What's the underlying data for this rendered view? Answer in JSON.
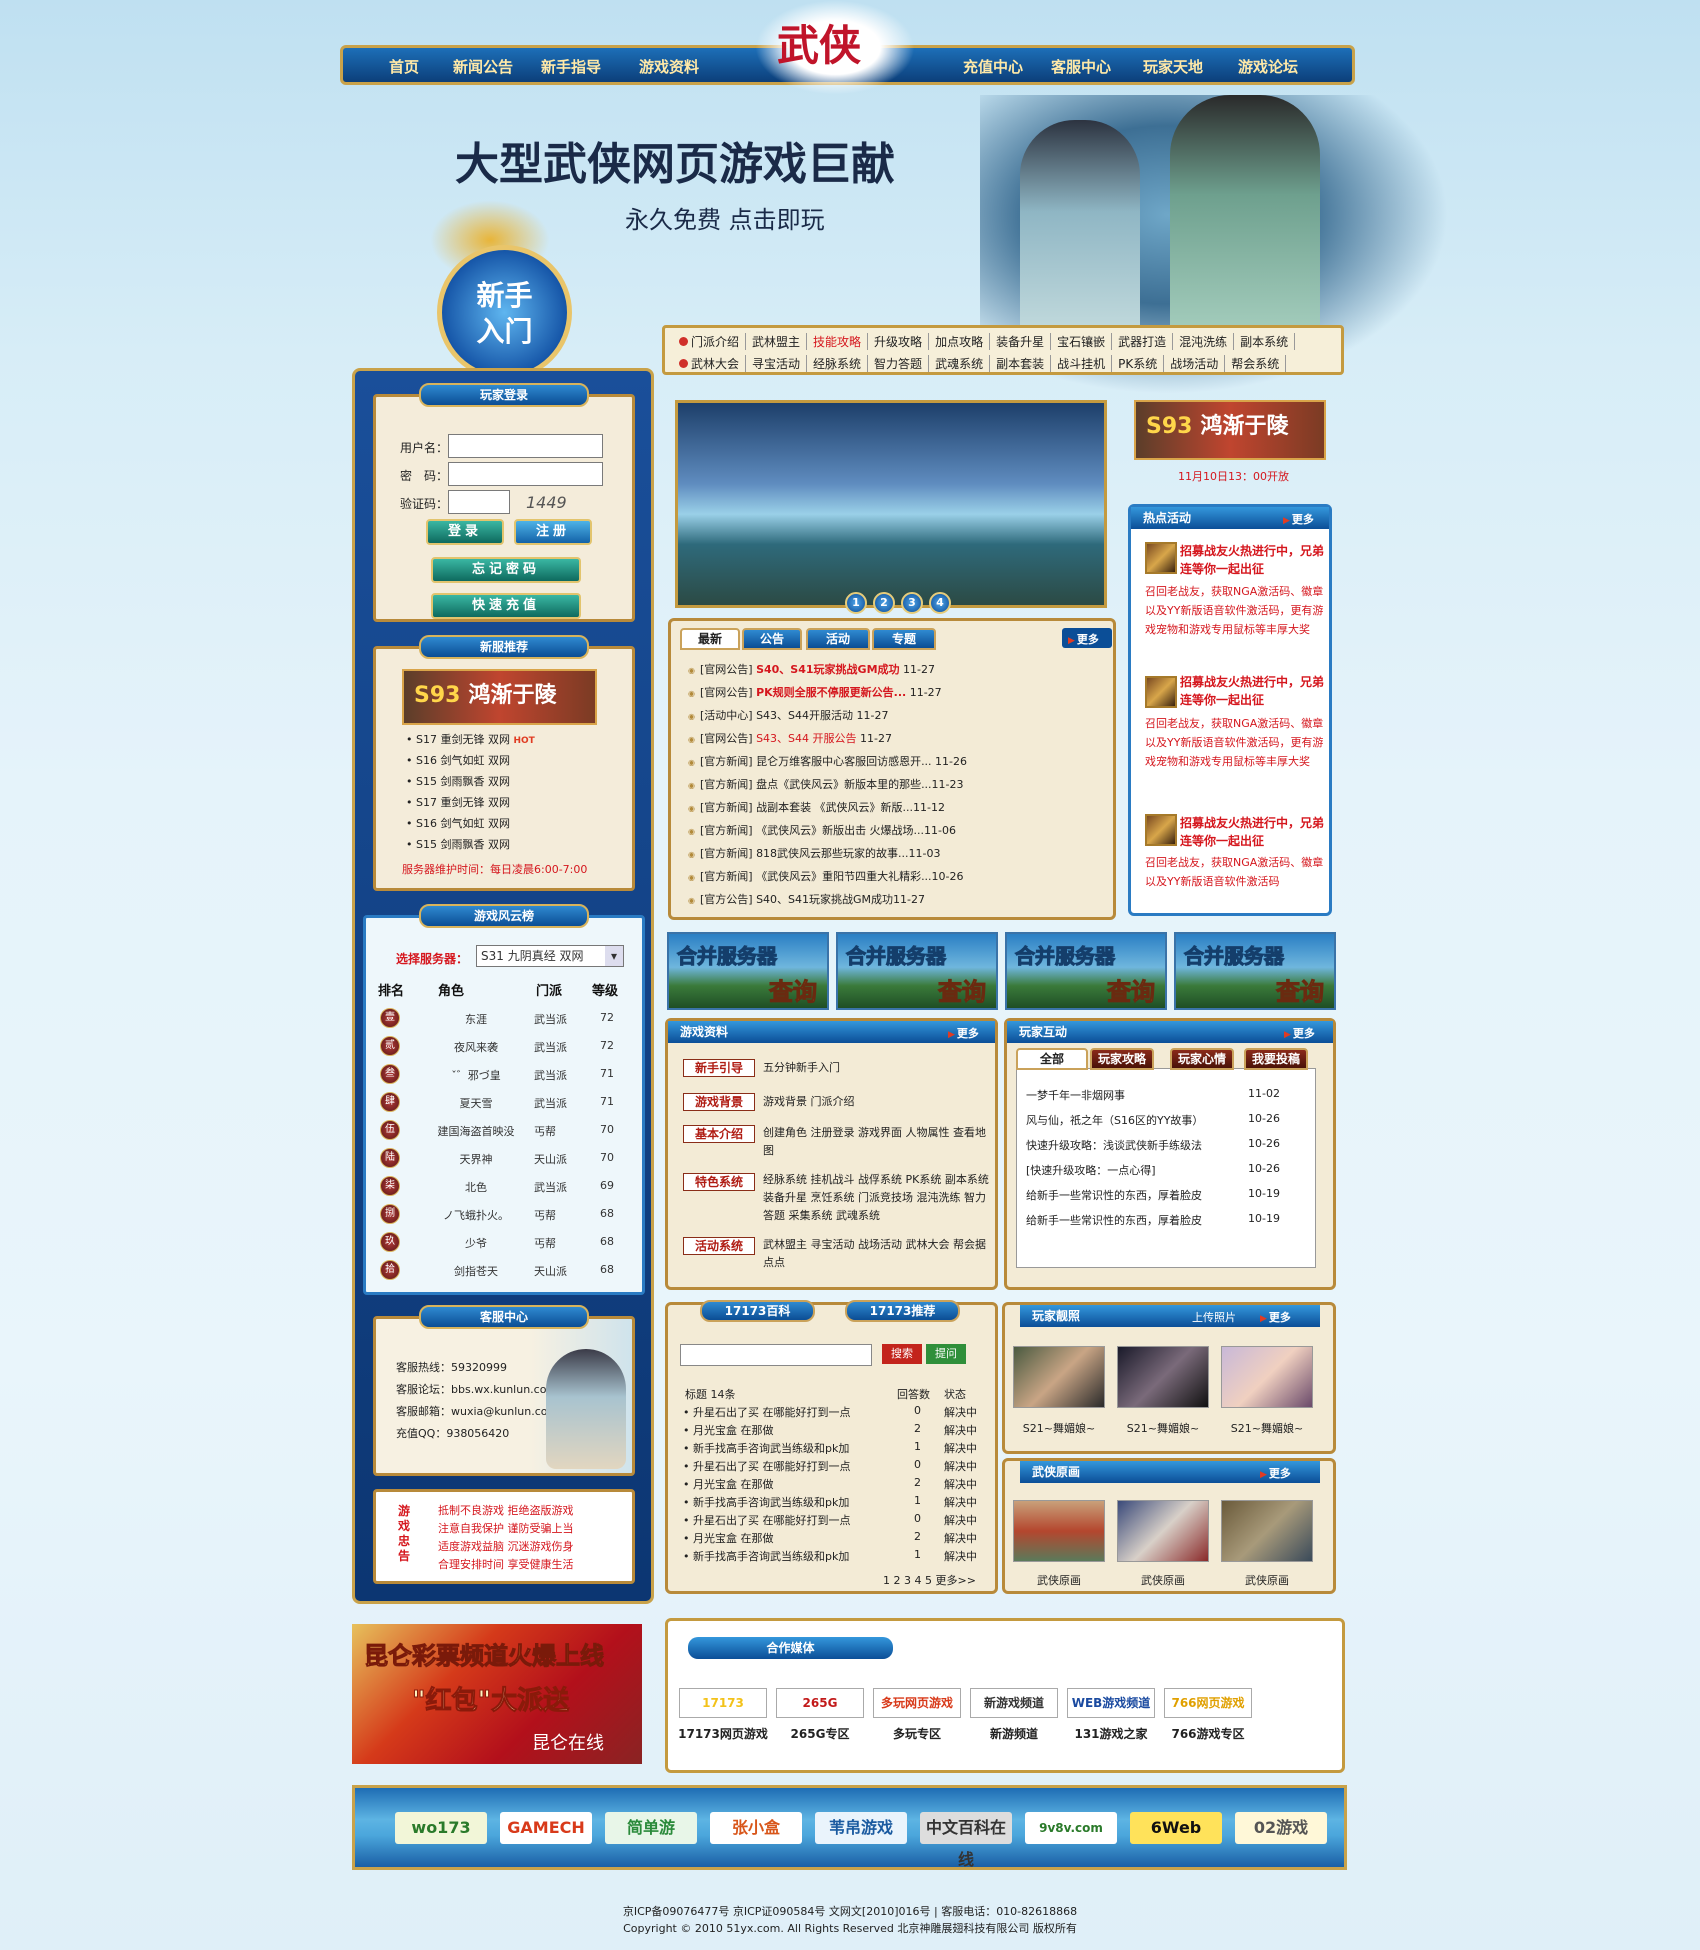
{
  "nav": {
    "left": [
      "首页",
      "新闻公告",
      "新手指导",
      "游戏资料"
    ],
    "right": [
      "充值中心",
      "客服中心",
      "玩家天地",
      "游戏论坛"
    ],
    "logo": "武侠"
  },
  "hero": {
    "title": "大型武侠网页游戏巨献",
    "subtitle": "永久免费 点击即玩",
    "newbie": "新手入门"
  },
  "links": {
    "row1": [
      "门派介绍",
      "武林盟主",
      "技能攻略",
      "升级攻略",
      "加点攻略",
      "装备升星",
      "宝石镶嵌",
      "武器打造",
      "混沌洗练",
      "副本系统"
    ],
    "row2": [
      "武林大会",
      "寻宝活动",
      "经脉系统",
      "智力答题",
      "武魂系统",
      "副本套装",
      "战斗挂机",
      "PK系统",
      "战场活动",
      "帮会系统"
    ]
  },
  "login": {
    "title": "玩家登录",
    "user_label": "用户名：",
    "pass_label": "密　码：",
    "code_label": "验证码：",
    "captcha": "1449",
    "login_btn": "登录",
    "register_btn": "注册",
    "forgot_btn": "忘记密码",
    "recharge_btn": "快速充值"
  },
  "servers": {
    "title": "新服推荐",
    "banner_num": "S93",
    "banner_text": "鸿渐于陵",
    "list": [
      "• S17  重剑无锋  双网",
      "• S16  剑气如虹  双网",
      "• S15  剑雨飘香  双网",
      "• S17  重剑无锋  双网",
      "• S16  剑气如虹  双网",
      "• S15  剑雨飘香  双网"
    ],
    "hot": "HOT",
    "maint": "服务器维护时间：每日凌晨6:00-7:00"
  },
  "ranking": {
    "title": "游戏风云榜",
    "select_label": "选择服务器：",
    "selected": "S31 九阴真经  双网",
    "headers": [
      "排名",
      "角色",
      "门派",
      "等级"
    ],
    "rows": [
      [
        "壹",
        "东涯",
        "武当派",
        "72"
      ],
      [
        "贰",
        "夜风来袭",
        "武当派",
        "72"
      ],
      [
        "叁",
        "ˇ゛邪づ皇",
        "武当派",
        "71"
      ],
      [
        "肆",
        "夏天雪",
        "武当派",
        "71"
      ],
      [
        "伍",
        "建国海盗首映没",
        "丐帮",
        "70"
      ],
      [
        "陆",
        "天界神",
        "天山派",
        "70"
      ],
      [
        "柒",
        "北色",
        "武当派",
        "69"
      ],
      [
        "捌",
        "ノ飞蛾扑火。",
        "丐帮",
        "68"
      ],
      [
        "玖",
        "少爷",
        "丐帮",
        "68"
      ],
      [
        "拾",
        "剑指苍天",
        "天山派",
        "68"
      ]
    ]
  },
  "service": {
    "title": "客服中心",
    "lines": [
      "客服热线：59320999",
      "客服论坛：bbs.wx.kunlun.com",
      "客服邮箱：wuxia@kunlun.com",
      "充值QQ：938056420"
    ]
  },
  "advice": {
    "title": "游戏忠告",
    "lines": [
      "抵制不良游戏 拒绝盗版游戏",
      "注意自我保护 谨防受骗上当",
      "适度游戏益脑 沉迷游戏伤身",
      "合理安排时间 享受健康生活"
    ]
  },
  "carousel": {
    "pages": [
      "1",
      "2",
      "3",
      "4"
    ]
  },
  "news": {
    "tabs": [
      "最新",
      "公告",
      "活动",
      "专题"
    ],
    "more": "更多",
    "items": [
      {
        "pre": "[官网公告] ",
        "hl": "S40、S41玩家挑战GM成功",
        "post": " 11-27"
      },
      {
        "pre": "[官网公告] ",
        "hl": "PK规则全服不停服更新公告...",
        "post": " 11-27"
      },
      {
        "pre": "[活动中心] S43、S44开服活动 11-27",
        "hl": "",
        "post": ""
      },
      {
        "pre": "[官网公告] ",
        "hl2": "S43、S44 开服公告",
        "post": " 11-27"
      },
      {
        "pre": "[官方新闻] 昆仑万维客服中心客服回访感恩开... 11-26",
        "hl": "",
        "post": ""
      },
      {
        "pre": "[官方新闻] 盘点《武侠风云》新版本里的那些...11-23",
        "hl": "",
        "post": ""
      },
      {
        "pre": "[官方新闻] 战副本套装 《武侠风云》新版...11-12",
        "hl": "",
        "post": ""
      },
      {
        "pre": "[官方新闻] 《武侠风云》新版出击 火爆战场...11-06",
        "hl": "",
        "post": ""
      },
      {
        "pre": "[官方新闻] 818武侠风云那些玩家的故事...11-03",
        "hl": "",
        "post": ""
      },
      {
        "pre": "[官方新闻] 《武侠风云》重阳节四重大礼精彩...10-26",
        "hl": "",
        "post": ""
      },
      {
        "pre": "[官方公告] S40、S41玩家挑战GM成功11-27",
        "hl": "",
        "post": ""
      }
    ]
  },
  "right_top": {
    "banner_num": "S93",
    "banner_text": "鸿渐于陵",
    "open_time": "11月10日13：00开放"
  },
  "hot_events": {
    "title": "热点活动",
    "more": "更多",
    "items": [
      {
        "title": "招募战友火热进行中，兄弟连等你一起出征",
        "desc": "召回老战友，获取NGA激活码、徽章以及YY新版语音软件激活码，更有游戏宠物和游戏专用鼠标等丰厚大奖"
      },
      {
        "title": "招募战友火热进行中，兄弟连等你一起出征",
        "desc": "召回老战友，获取NGA激活码、徽章以及YY新版语音软件激活码，更有游戏宠物和游戏专用鼠标等丰厚大奖"
      },
      {
        "title": "招募战友火热进行中，兄弟连等你一起出征",
        "desc": "召回老战友，获取NGA激活码、徽章以及YY新版语音软件激活码"
      }
    ]
  },
  "merge": {
    "top": "合并服务器",
    "bottom": "查询"
  },
  "gameinfo": {
    "title": "游戏资料",
    "more": "更多",
    "rows": [
      {
        "tag": "新手引导",
        "text": "五分钟新手入门"
      },
      {
        "tag": "游戏背景",
        "text": "游戏背景  门派介绍"
      },
      {
        "tag": "基本介绍",
        "text": "创建角色  注册登录  游戏界面  人物属性  查看地图"
      },
      {
        "tag": "特色系统",
        "text": "经脉系统  挂机战斗  战俘系统  PK系统  副本系统  装备升星  烹饪系统  门派竞技场  混沌洗练  智力答题  采集系统  武魂系统"
      },
      {
        "tag": "活动系统",
        "text": "武林盟主  寻宝活动  战场活动  武林大会  帮会据点点"
      }
    ]
  },
  "interact": {
    "title": "玩家互动",
    "more": "更多",
    "tabs": [
      "全部",
      "玩家攻略",
      "玩家心情",
      "我要投稿"
    ],
    "items": [
      [
        "一梦千年一非烟网事",
        "11-02"
      ],
      [
        "风与仙，祇之年（S16区的YY故事）",
        "10-26"
      ],
      [
        "快速升级攻略：浅谈武侠新手练级法",
        "10-26"
      ],
      [
        "[快速升级攻略：一点心得]",
        "10-26"
      ],
      [
        "给新手一些常识性的东西，厚着脸皮",
        "10-19"
      ],
      [
        "给新手一些常识性的东西，厚着脸皮",
        "10-19"
      ]
    ]
  },
  "baike": {
    "tab1": "17173百科",
    "tab2": "17173推荐",
    "search_btn": "搜索",
    "ask_btn": "提问",
    "headers": [
      "标题   14条",
      "回答数",
      "状态"
    ],
    "rows": [
      [
        "• 升星石出了买 在哪能好打到一点",
        "0",
        "解决中"
      ],
      [
        "• 月光宝盒 在那做",
        "2",
        "解决中"
      ],
      [
        "• 新手找高手咨询武当练级和pk加",
        "1",
        "解决中"
      ],
      [
        "• 升星石出了买 在哪能好打到一点",
        "0",
        "解决中"
      ],
      [
        "• 月光宝盒 在那做",
        "2",
        "解决中"
      ],
      [
        "• 新手找高手咨询武当练级和pk加",
        "1",
        "解决中"
      ],
      [
        "• 升星石出了买 在哪能好打到一点",
        "0",
        "解决中"
      ],
      [
        "• 月光宝盒 在那做",
        "2",
        "解决中"
      ],
      [
        "• 新手找高手咨询武当练级和pk加",
        "1",
        "解决中"
      ]
    ],
    "pages": "1 2 3 4 5  更多>>"
  },
  "photos": {
    "title": "玩家靓照",
    "upload": "上传照片",
    "more": "更多",
    "caps": [
      "S21~舞媚娘~",
      "S21~舞媚娘~",
      "S21~舞媚娘~"
    ]
  },
  "artwork": {
    "title": "武侠原画",
    "more": "更多",
    "caps": [
      "武侠原画",
      "武侠原画",
      "武侠原画"
    ]
  },
  "lotto": {
    "line1": "昆仑彩票频道火爆上线",
    "line2": "\"红包\"大派送",
    "brand": "昆仑在线"
  },
  "media": {
    "title": "合作媒体",
    "logos": [
      "17173",
      "265G",
      "多玩网页游戏",
      "新游戏频道",
      "WEB游戏频道",
      "766网页游戏"
    ],
    "caps": [
      "17173网页游戏",
      "265G专区",
      "多玩专区",
      "新游频道",
      "131游戏之家",
      "766游戏专区"
    ]
  },
  "friends": [
    "wo173",
    "GAMECH",
    "简单游",
    "张小盒",
    "苇帛游戏",
    "中文百科在线",
    "9v8v.com",
    "6Web",
    "02游戏"
  ],
  "footer": {
    "line1": "京ICP备09076477号  京ICP证090584号  文网文[2010]016号  |  客服电话：010-82618868",
    "line2": "Copyright © 2010 51yx.com. All Rights Reserved  北京神雕展翅科技有限公司  版权所有"
  }
}
